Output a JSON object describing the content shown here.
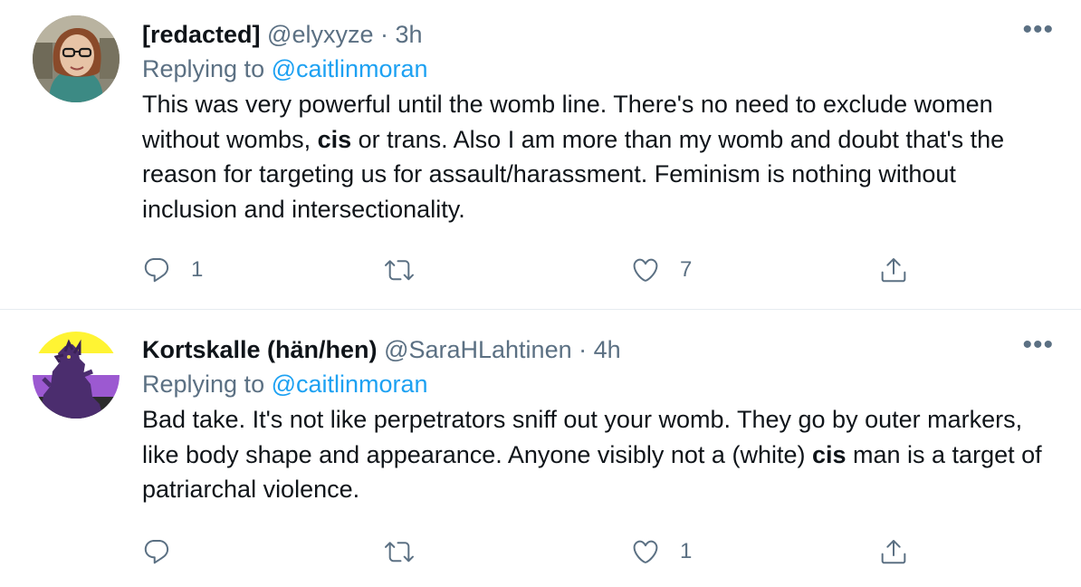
{
  "tweets": [
    {
      "name": "[redacted]",
      "handle": "@elyxyze",
      "separator": "·",
      "time": "3h",
      "replying_prefix": "Replying to",
      "replying_to": "@caitlinmoran",
      "body_1": "This was very powerful until the womb line. There's no need to exclude women without wombs, ",
      "body_bold": "cis",
      "body_2": " or trans. Also I am more than my womb and doubt that's the reason for targeting us for assault/harassment. Feminism is nothing without inclusion and intersectionality.",
      "reply_count": "1",
      "retweet_count": "",
      "like_count": "7",
      "more_icon": "more-horizontal-icon"
    },
    {
      "name": "Kortskalle (hän/hen)",
      "handle": "@SaraHLahtinen",
      "separator": "·",
      "time": "4h",
      "replying_prefix": "Replying to",
      "replying_to": "@caitlinmoran",
      "body_1": "Bad take. It's not like perpetrators sniff out your womb. They go by outer markers, like body shape and appearance. Anyone visibly not a (white) ",
      "body_bold": "cis",
      "body_2": " man is a target of patriarchal violence.",
      "reply_count": "",
      "retweet_count": "",
      "like_count": "1",
      "more_icon": "more-horizontal-icon"
    }
  ],
  "icons": {
    "reply": "reply-bubble-icon",
    "retweet": "retweet-icon",
    "like": "heart-icon",
    "share": "share-icon"
  },
  "colors": {
    "text": "#0f1419",
    "secondary": "#5b7083",
    "link": "#1da1f2",
    "divider": "#e6ecf0"
  }
}
